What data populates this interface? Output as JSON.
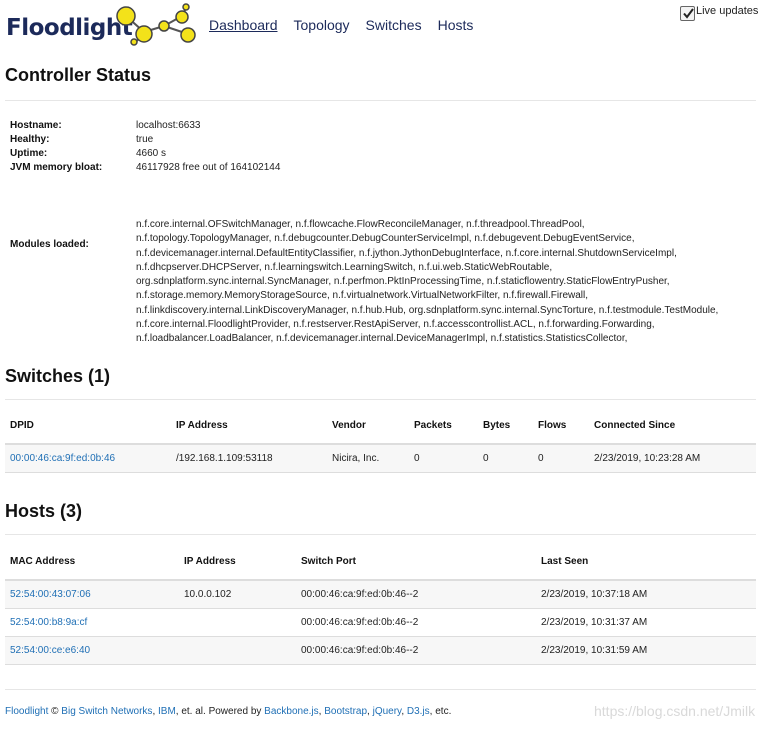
{
  "nav": {
    "brand": "Floodlight",
    "links": [
      "Dashboard",
      "Topology",
      "Switches",
      "Hosts"
    ],
    "live_updates": "Live updates"
  },
  "controller": {
    "title": "Controller Status",
    "rows": [
      {
        "label": "Hostname:",
        "value": "localhost:6633"
      },
      {
        "label": "Healthy:",
        "value": "true"
      },
      {
        "label": "Uptime:",
        "value": "4660 s"
      },
      {
        "label": "JVM memory bloat:",
        "value": "46117928 free out of 164102144"
      }
    ],
    "modules_label": "Modules loaded:",
    "modules_lines": [
      "n.f.core.internal.OFSwitchManager, n.f.flowcache.FlowReconcileManager, n.f.threadpool.ThreadPool,",
      "n.f.topology.TopologyManager, n.f.debugcounter.DebugCounterServiceImpl, n.f.debugevent.DebugEventService,",
      "n.f.devicemanager.internal.DefaultEntityClassifier, n.f.jython.JythonDebugInterface, n.f.core.internal.ShutdownServiceImpl,",
      "n.f.dhcpserver.DHCPServer, n.f.learningswitch.LearningSwitch, n.f.ui.web.StaticWebRoutable,",
      "org.sdnplatform.sync.internal.SyncManager, n.f.perfmon.PktInProcessingTime, n.f.staticflowentry.StaticFlowEntryPusher,",
      "n.f.storage.memory.MemoryStorageSource, n.f.virtualnetwork.VirtualNetworkFilter, n.f.firewall.Firewall,",
      "n.f.linkdiscovery.internal.LinkDiscoveryManager, n.f.hub.Hub, org.sdnplatform.sync.internal.SyncTorture, n.f.testmodule.TestModule,",
      "n.f.core.internal.FloodlightProvider, n.f.restserver.RestApiServer, n.f.accesscontrollist.ACL, n.f.forwarding.Forwarding,",
      "n.f.loadbalancer.LoadBalancer, n.f.devicemanager.internal.DeviceManagerImpl, n.f.statistics.StatisticsCollector,"
    ]
  },
  "switches": {
    "title": "Switches (1)",
    "columns": [
      "DPID",
      "IP Address",
      "Vendor",
      "Packets",
      "Bytes",
      "Flows",
      "Connected Since"
    ],
    "rows": [
      [
        "00:00:46:ca:9f:ed:0b:46",
        "/192.168.1.109:53118",
        "Nicira, Inc.",
        "0",
        "0",
        "0",
        "2/23/2019, 10:23:28 AM"
      ]
    ]
  },
  "hosts": {
    "title": "Hosts (3)",
    "columns": [
      "MAC Address",
      "IP Address",
      "Switch Port",
      "Last Seen"
    ],
    "rows": [
      [
        "52:54:00:43:07:06",
        "10.0.0.102",
        "00:00:46:ca:9f:ed:0b:46--2",
        "2/23/2019, 10:37:18 AM"
      ],
      [
        "52:54:00:b8:9a:cf",
        "",
        "00:00:46:ca:9f:ed:0b:46--2",
        "2/23/2019, 10:31:37 AM"
      ],
      [
        "52:54:00:ce:e6:40",
        "",
        "00:00:46:ca:9f:ed:0b:46--2",
        "2/23/2019, 10:31:59 AM"
      ]
    ]
  },
  "footer": {
    "floodlight": "Floodlight",
    "copy": " © ",
    "bsn": "Big Switch Networks",
    "sep1": ", ",
    "ibm": "IBM",
    "mid": ", et. al. Powered by ",
    "backbone": "Backbone.js",
    "sep2": ", ",
    "bootstrap": "Bootstrap",
    "sep3": ", ",
    "jquery": "jQuery",
    "sep4": ", ",
    "d3": "D3.js",
    "end": ", etc."
  },
  "watermark": "https://blog.csdn.net/Jmilk"
}
